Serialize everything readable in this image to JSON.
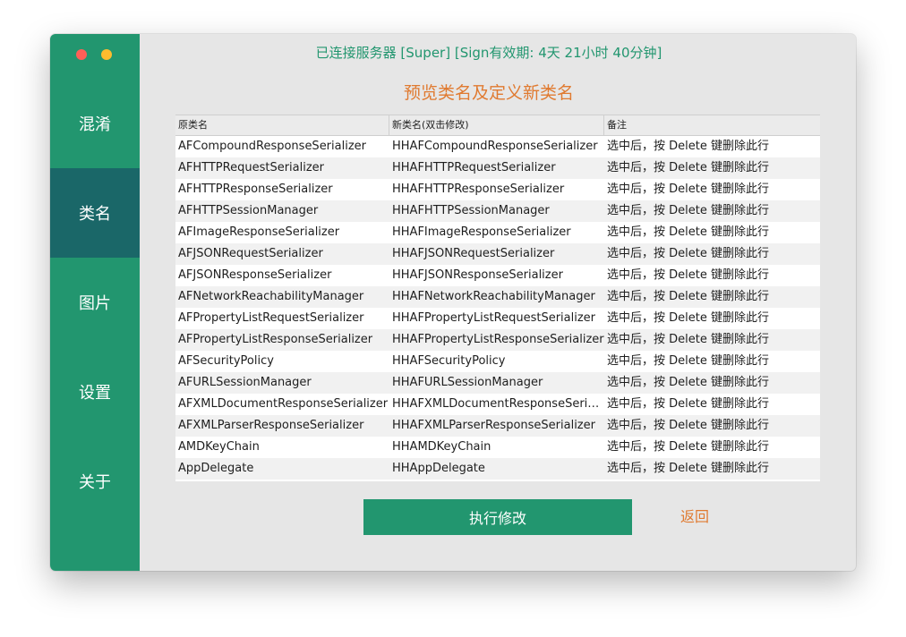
{
  "window": {
    "status": "已连接服务器 [Super] [Sign有效期: 4天 21小时 40分钟]",
    "heading": "预览类名及定义新类名"
  },
  "sidebar": {
    "items": [
      {
        "label": "混淆",
        "active": false
      },
      {
        "label": "类名",
        "active": true
      },
      {
        "label": "图片",
        "active": false
      },
      {
        "label": "设置",
        "active": false
      },
      {
        "label": "关于",
        "active": false
      }
    ]
  },
  "table": {
    "headers": [
      "原类名",
      "新类名(双击修改)",
      "备注"
    ],
    "rows": [
      [
        "AFCompoundResponseSerializer",
        "HHAFCompoundResponseSerializer",
        "选中后，按 Delete 键删除此行"
      ],
      [
        "AFHTTPRequestSerializer",
        "HHAFHTTPRequestSerializer",
        "选中后，按 Delete 键删除此行"
      ],
      [
        "AFHTTPResponseSerializer",
        "HHAFHTTPResponseSerializer",
        "选中后，按 Delete 键删除此行"
      ],
      [
        "AFHTTPSessionManager",
        "HHAFHTTPSessionManager",
        "选中后，按 Delete 键删除此行"
      ],
      [
        "AFImageResponseSerializer",
        "HHAFImageResponseSerializer",
        "选中后，按 Delete 键删除此行"
      ],
      [
        "AFJSONRequestSerializer",
        "HHAFJSONRequestSerializer",
        "选中后，按 Delete 键删除此行"
      ],
      [
        "AFJSONResponseSerializer",
        "HHAFJSONResponseSerializer",
        "选中后，按 Delete 键删除此行"
      ],
      [
        "AFNetworkReachabilityManager",
        "HHAFNetworkReachabilityManager",
        "选中后，按 Delete 键删除此行"
      ],
      [
        "AFPropertyListRequestSerializer",
        "HHAFPropertyListRequestSerializer",
        "选中后，按 Delete 键删除此行"
      ],
      [
        "AFPropertyListResponseSerializer",
        "HHAFPropertyListResponseSerializer",
        "选中后，按 Delete 键删除此行"
      ],
      [
        "AFSecurityPolicy",
        "HHAFSecurityPolicy",
        "选中后，按 Delete 键删除此行"
      ],
      [
        "AFURLSessionManager",
        "HHAFURLSessionManager",
        "选中后，按 Delete 键删除此行"
      ],
      [
        "AFXMLDocumentResponseSerializer",
        "HHAFXMLDocumentResponseSeriali...",
        "选中后，按 Delete 键删除此行"
      ],
      [
        "AFXMLParserResponseSerializer",
        "HHAFXMLParserResponseSerializer",
        "选中后，按 Delete 键删除此行"
      ],
      [
        "AMDKeyChain",
        "HHAMDKeyChain",
        "选中后，按 Delete 键删除此行"
      ],
      [
        "AppDelegate",
        "HHAppDelegate",
        "选中后，按 Delete 键删除此行"
      ]
    ]
  },
  "actions": {
    "execute_label": "执行修改",
    "back_label": "返回"
  },
  "colors": {
    "sidebar": "#22966f",
    "sidebar_active": "#1a6768",
    "status_text": "#22966f",
    "heading_text": "#e07a30",
    "execute_button": "#22966f",
    "back_text": "#e07a30"
  }
}
